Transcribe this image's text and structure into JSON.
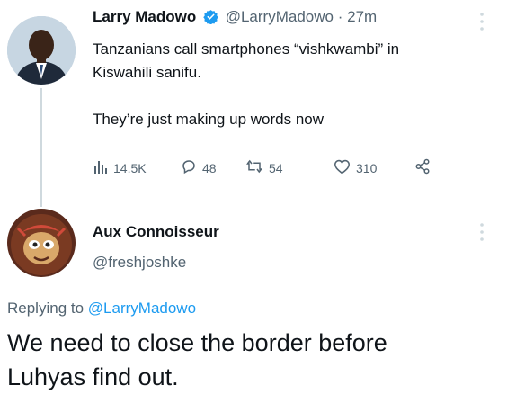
{
  "tweet": {
    "author_name": "Larry Madowo",
    "handle": "@LarryMadowo",
    "separator": "·",
    "time": "27m",
    "text_line1": "Tanzanians call smartphones “vishkwambi” in",
    "text_line2": "Kiswahili sanifu.",
    "text_line3": "They’re just making up words now",
    "stats": {
      "views": "14.5K",
      "replies": "48",
      "retweets": "54",
      "likes": "310"
    }
  },
  "reply": {
    "author_name": "Aux Connoisseur",
    "handle": "@freshjoshke",
    "replying_prefix": "Replying to",
    "replying_to": "@LarryMadowo",
    "text_line1": "We need to close the border before",
    "text_line2": "Luhyas find out."
  },
  "colors": {
    "verified": "#1d9bf0",
    "link": "#1d9bf0",
    "secondary_text": "#536471"
  },
  "icons": [
    "verified-badge-icon",
    "more-icon",
    "views-icon",
    "reply-icon",
    "retweet-icon",
    "like-icon",
    "share-icon"
  ]
}
